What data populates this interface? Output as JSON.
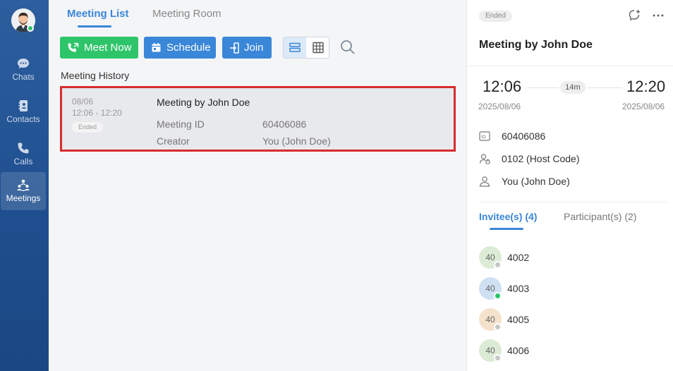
{
  "sidebar": {
    "items": [
      {
        "label": "Chats",
        "icon": "chat-bubble-icon"
      },
      {
        "label": "Contacts",
        "icon": "contacts-book-icon"
      },
      {
        "label": "Calls",
        "icon": "phone-icon"
      },
      {
        "label": "Meetings",
        "icon": "meetings-people-icon",
        "active": true
      }
    ]
  },
  "tabs": [
    {
      "label": "Meeting List",
      "active": true
    },
    {
      "label": "Meeting Room",
      "active": false
    }
  ],
  "toolbar": {
    "meet_now": "Meet Now",
    "schedule": "Schedule",
    "join": "Join"
  },
  "history": {
    "title": "Meeting History",
    "meetings": [
      {
        "date": "08/06",
        "time": "12:06 - 12:20",
        "status": "Ended",
        "title": "Meeting by John Doe",
        "id_label": "Meeting ID",
        "id_value": "60406086",
        "creator_label": "Creator",
        "creator_value": "You (John Doe)"
      }
    ]
  },
  "detail": {
    "status": "Ended",
    "title": "Meeting by John Doe",
    "start_time": "12:06",
    "end_time": "12:20",
    "start_date": "2025/08/06",
    "end_date": "2025/08/06",
    "duration": "14m",
    "meeting_id": "60406086",
    "host_code": "0102 (Host Code)",
    "creator": "You (John Doe)",
    "tabs": [
      {
        "label": "Invitee(s) (4)",
        "active": true
      },
      {
        "label": "Participant(s) (2)",
        "active": false
      }
    ],
    "invitees": [
      {
        "initials": "40",
        "name": "4002",
        "avatar_color": "#dcebd5",
        "status_color": "#c7c7c7"
      },
      {
        "initials": "40",
        "name": "4003",
        "avatar_color": "#cfe0f3",
        "status_color": "#2ac46b"
      },
      {
        "initials": "40",
        "name": "4005",
        "avatar_color": "#f5e2cc",
        "status_color": "#c7c7c7"
      },
      {
        "initials": "40",
        "name": "4006",
        "avatar_color": "#dcebd5",
        "status_color": "#c7c7c7"
      }
    ]
  },
  "colors": {
    "accent": "#3a86d8",
    "green": "#2ec46a",
    "highlight_border": "#d62d2d"
  }
}
